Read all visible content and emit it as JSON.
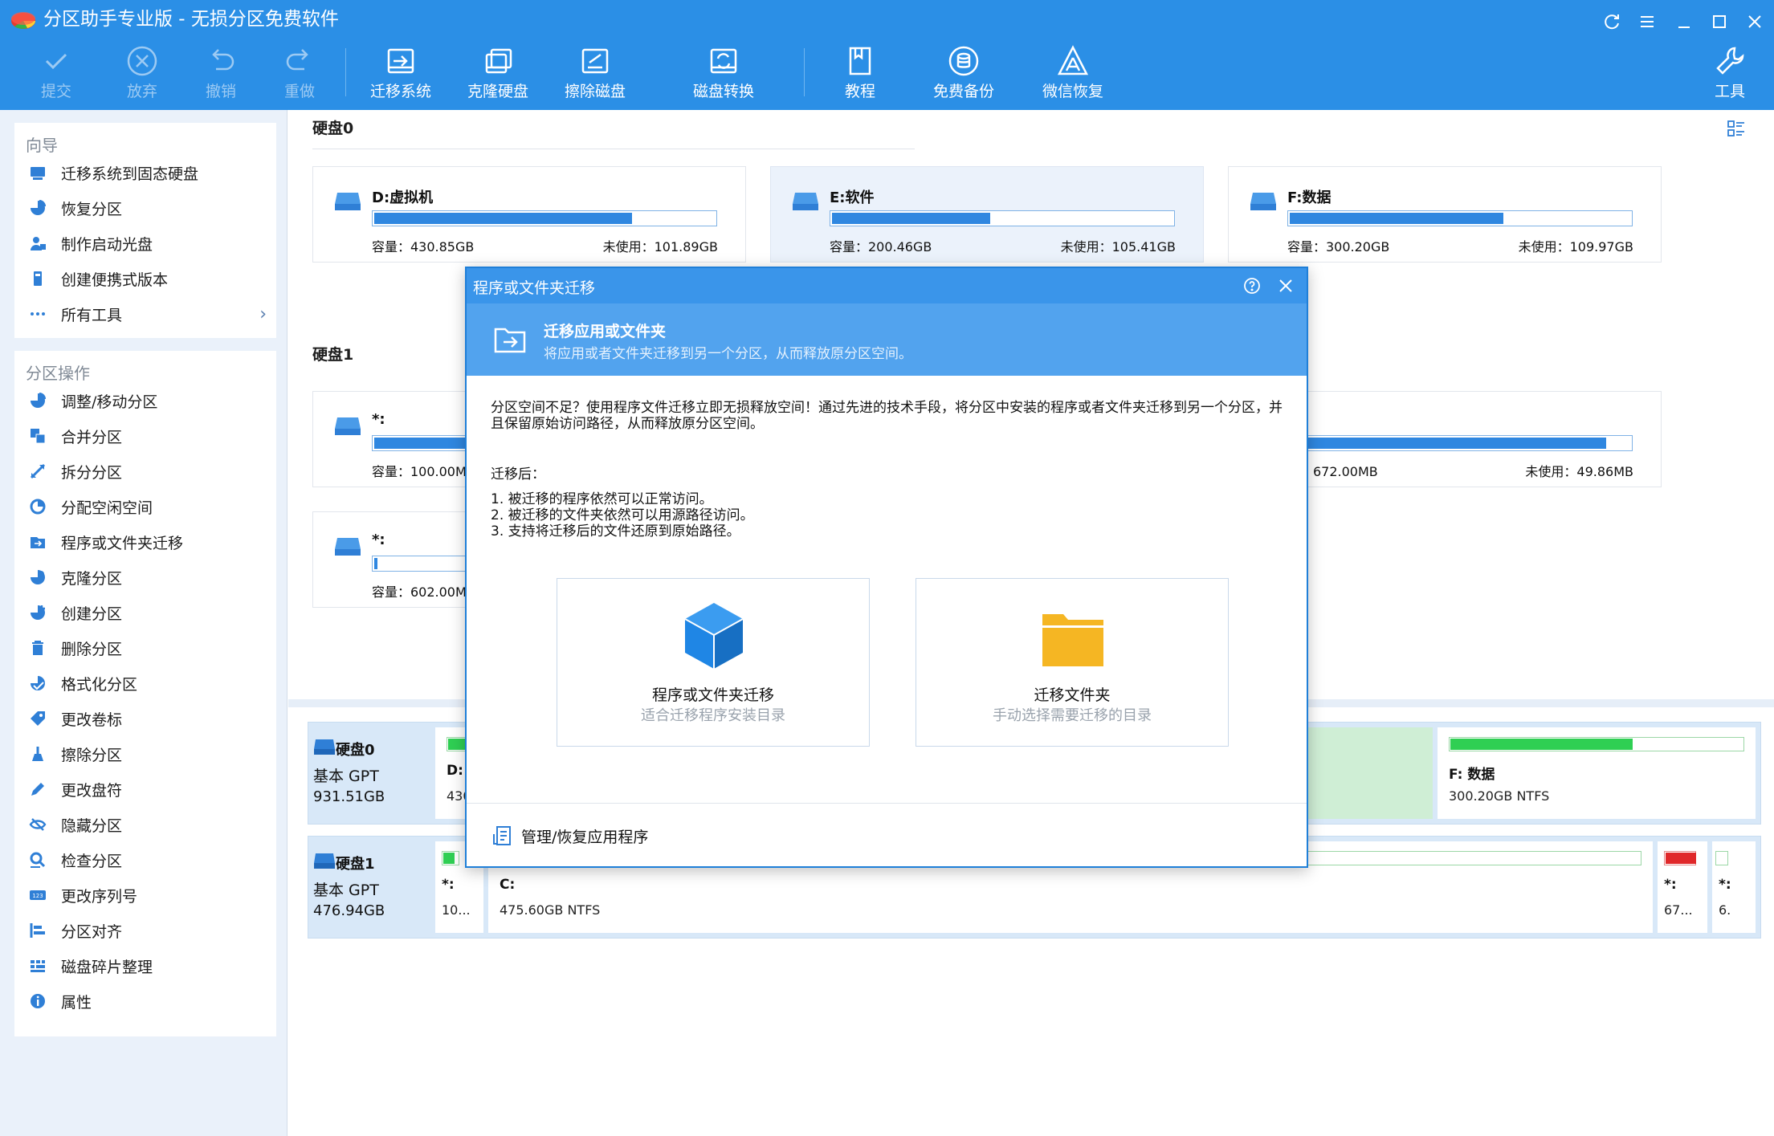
{
  "window": {
    "title": "分区助手专业版 - 无损分区免费软件"
  },
  "toolbar": {
    "commit": "提交",
    "discard": "放弃",
    "undo": "撤销",
    "redo": "重做",
    "migrate_os": "迁移系统",
    "clone_disk": "克隆硬盘",
    "wipe_disk": "擦除磁盘",
    "disk_convert": "磁盘转换",
    "tutorial": "教程",
    "free_backup": "免费备份",
    "wechat_recovery": "微信恢复",
    "tools": "工具"
  },
  "sidebar": {
    "wizard_header": "向导",
    "wizard_items": [
      {
        "label": "迁移系统到固态硬盘",
        "icon": "ssd-migrate-icon"
      },
      {
        "label": "恢复分区",
        "icon": "pie-restore-icon"
      },
      {
        "label": "制作启动光盘",
        "icon": "boot-disc-icon"
      },
      {
        "label": "创建便携式版本",
        "icon": "portable-icon"
      },
      {
        "label": "所有工具",
        "icon": "more-dots-icon"
      }
    ],
    "ops_header": "分区操作",
    "ops_items": [
      {
        "label": "调整/移动分区",
        "icon": "resize-icon"
      },
      {
        "label": "合并分区",
        "icon": "merge-icon"
      },
      {
        "label": "拆分分区",
        "icon": "split-icon"
      },
      {
        "label": "分配空闲空间",
        "icon": "allocate-icon"
      },
      {
        "label": "程序或文件夹迁移",
        "icon": "app-move-icon"
      },
      {
        "label": "克隆分区",
        "icon": "clone-icon"
      },
      {
        "label": "创建分区",
        "icon": "create-icon"
      },
      {
        "label": "删除分区",
        "icon": "trash-icon"
      },
      {
        "label": "格式化分区",
        "icon": "format-icon"
      },
      {
        "label": "更改卷标",
        "icon": "tag-icon"
      },
      {
        "label": "擦除分区",
        "icon": "broom-icon"
      },
      {
        "label": "更改盘符",
        "icon": "pencil-icon"
      },
      {
        "label": "隐藏分区",
        "icon": "hide-icon"
      },
      {
        "label": "检查分区",
        "icon": "check-icon"
      },
      {
        "label": "更改序列号",
        "icon": "serial-icon"
      },
      {
        "label": "分区对齐",
        "icon": "align-icon"
      },
      {
        "label": "磁盘碎片整理",
        "icon": "defrag-icon"
      },
      {
        "label": "属性",
        "icon": "info-icon"
      }
    ]
  },
  "disk0": {
    "title": "硬盘0",
    "partitions": [
      {
        "name": "D:虚拟机",
        "capacity": "容量：430.85GB",
        "free": "未使用：101.89GB",
        "used_fraction": 0.76
      },
      {
        "name": "E:软件",
        "capacity": "容量：200.46GB",
        "free": "未使用：105.41GB",
        "used_fraction": 0.47
      },
      {
        "name": "F:数据",
        "capacity": "容量：300.20GB",
        "free": "未使用：109.97GB",
        "used_fraction": 0.63
      }
    ]
  },
  "disk1": {
    "title": "硬盘1",
    "partitions": [
      {
        "name": "*:",
        "capacity": "容量：100.00M"
      },
      {
        "name": "*:",
        "capacity": "容量：602.00M"
      }
    ],
    "right_card": {
      "capacity": "量：672.00MB",
      "free": "未使用：49.86MB",
      "used_fraction": 0.93
    }
  },
  "bottom": {
    "disk0": {
      "name": "硬盘0",
      "type": "基本 GPT",
      "size": "931.51GB",
      "part_d_label": "D: ",
      "part_d_size": "430",
      "part_f_label": "F: 数据",
      "part_f_size": "300.20GB NTFS",
      "part_f_used_fraction": 0.63
    },
    "disk1": {
      "name": "硬盘1",
      "type": "基本 GPT",
      "size": "476.94GB",
      "part1_label": "*:",
      "part1_size": "10...",
      "part_c_label": "C:",
      "part_c_size": "475.60GB NTFS",
      "part3_label": "*:",
      "part3_size": "67...",
      "part4_label": "*:",
      "part4_size": "6."
    }
  },
  "dialog": {
    "title": "程序或文件夹迁移",
    "header_title": "迁移应用或文件夹",
    "header_subtitle": "将应用或者文件夹迁移到另一个分区，从而释放原分区空间。",
    "description": "分区空间不足？使用程序文件迁移立即无损释放空间！通过先进的技术手段，将分区中安装的程序或者文件夹迁移到另一个分区，并且保留原始访问路径，从而释放原分区空间。",
    "after_label": "迁移后：",
    "after_items": [
      "1. 被迁移的程序依然可以正常访问。",
      "2. 被迁移的文件夹依然可以用源路径访问。",
      "3. 支持将迁移后的文件还原到原始路径。"
    ],
    "option_app": {
      "title": "程序或文件夹迁移",
      "subtitle": "适合迁移程序安装目录"
    },
    "option_folder": {
      "title": "迁移文件夹",
      "subtitle": "手动选择需要迁移的目录"
    },
    "manage_label": "管理/恢复应用程序"
  },
  "colors": {
    "title_bar": "#2b8fe6",
    "dialog_header": "#52a3ee",
    "usage_bar": "#2f87e0",
    "usage_bar_green": "#2fcf53",
    "usage_bar_red": "#e0282a",
    "cube_blue": "#1f86e5",
    "folder_yellow": "#f5b623"
  }
}
